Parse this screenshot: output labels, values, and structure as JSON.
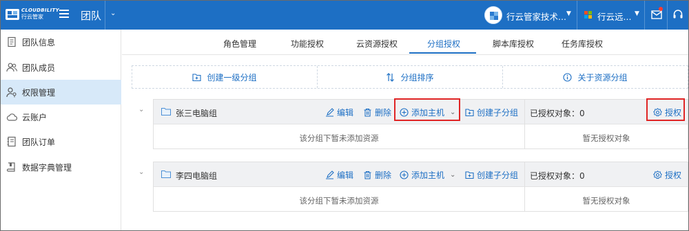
{
  "brand": {
    "name": "CLOUDBILITY",
    "sub": "行云管家"
  },
  "nav": {
    "title": "团队"
  },
  "header": {
    "org_name": "行云管家技术...",
    "user_name": "行云远..."
  },
  "sidebar": {
    "items": [
      {
        "label": "团队信息",
        "icon": "document-icon"
      },
      {
        "label": "团队成员",
        "icon": "members-icon"
      },
      {
        "label": "权限管理",
        "icon": "permission-icon",
        "active": true
      },
      {
        "label": "云账户",
        "icon": "cloud-icon"
      },
      {
        "label": "团队订单",
        "icon": "order-icon"
      },
      {
        "label": "数据字典管理",
        "icon": "dictionary-icon"
      }
    ]
  },
  "tabs": [
    {
      "label": "角色管理"
    },
    {
      "label": "功能授权"
    },
    {
      "label": "云资源授权"
    },
    {
      "label": "分组授权",
      "active": true
    },
    {
      "label": "脚本库授权"
    },
    {
      "label": "任务库授权"
    }
  ],
  "actions": {
    "create_group": "创建一级分组",
    "sort_group": "分组排序",
    "about_group": "关于资源分组"
  },
  "groups": [
    {
      "name": "张三电脑组",
      "edit": "编辑",
      "delete": "删除",
      "add_host": "添加主机",
      "create_sub": "创建子分组",
      "auth_count": "已授权对象：0",
      "authorize": "授权",
      "empty_text": "该分组下暂未添加资源",
      "no_auth_text": "暂无授权对象"
    },
    {
      "name": "李四电脑组",
      "edit": "编辑",
      "delete": "删除",
      "add_host": "添加主机",
      "create_sub": "创建子分组",
      "auth_count": "已授权对象：0",
      "authorize": "授权",
      "empty_text": "该分组下暂未添加资源",
      "no_auth_text": "暂无授权对象"
    }
  ],
  "colors": {
    "primary": "#1d6fc4",
    "highlight": "#e02424",
    "sidebar_active": "#d7e9f9"
  }
}
